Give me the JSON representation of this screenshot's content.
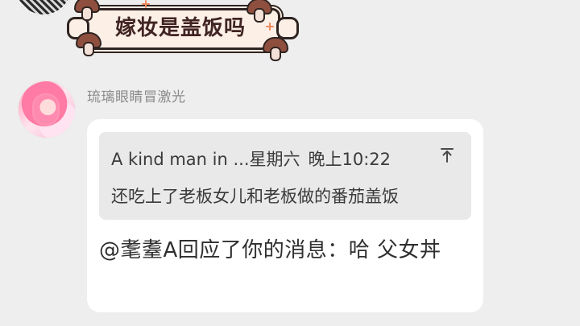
{
  "sticker": {
    "text": "嫁妆是盖饭吗"
  },
  "sender": {
    "name": "琉璃眼睛冒激光"
  },
  "bubble": {
    "quote": {
      "author_prefix": "A kind man in ...",
      "day": "星期六",
      "time": "晚上10:22",
      "text": "还吃上了老板女儿和老板做的番茄盖饭"
    },
    "message_text": "@耄耋A回应了你的消息：哈 父女丼"
  },
  "colors": {
    "background": "#eeeeee",
    "bubble": "#ffffff",
    "quote_bg": "#e9e9e9",
    "sender_name": "#8b8b8b",
    "text": "#2f2f2f"
  },
  "icons": {
    "jump": "arrow-up-to-line"
  }
}
